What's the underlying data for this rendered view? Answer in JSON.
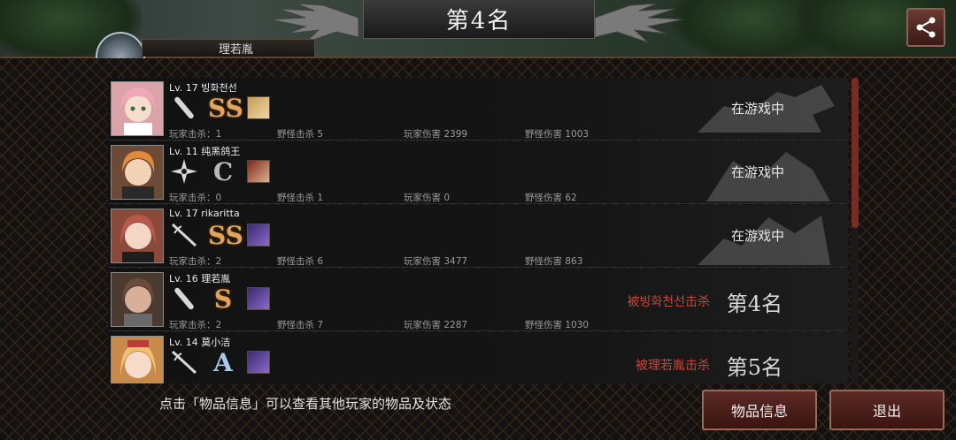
{
  "header": {
    "title": "第4名",
    "player_tag": "理若胤"
  },
  "players": [
    {
      "level_name": "Lv. 17 빙화천선",
      "grade": "SS",
      "status": "在游戏中",
      "killed_by": "",
      "rank": "",
      "stats": {
        "player_kills": "玩家击杀：1",
        "monster_kills": "野怪击杀 5",
        "player_damage": "玩家伤害 2399",
        "monster_damage": "野怪伤害 1003"
      }
    },
    {
      "level_name": "Lv. 11 纯黑鸽王",
      "grade": "C",
      "status": "在游戏中",
      "killed_by": "",
      "rank": "",
      "stats": {
        "player_kills": "玩家击杀：0",
        "monster_kills": "野怪击杀 1",
        "player_damage": "玩家伤害 0",
        "monster_damage": "野怪伤害 62"
      }
    },
    {
      "level_name": "Lv. 17 rikaritta",
      "grade": "SS",
      "status": "在游戏中",
      "killed_by": "",
      "rank": "",
      "stats": {
        "player_kills": "玩家击杀：2",
        "monster_kills": "野怪击杀 6",
        "player_damage": "玩家伤害 3477",
        "monster_damage": "野怪伤害 863"
      }
    },
    {
      "level_name": "Lv. 16 理若胤",
      "grade": "S",
      "status": "",
      "killed_by": "被빙화천선击杀",
      "rank": "第4名",
      "stats": {
        "player_kills": "玩家击杀：2",
        "monster_kills": "野怪击杀 7",
        "player_damage": "玩家伤害 2287",
        "monster_damage": "野怪伤害 1030"
      }
    },
    {
      "level_name": "Lv. 14 莫小洁",
      "grade": "A",
      "status": "",
      "killed_by": "被理若胤击杀",
      "rank": "第5名",
      "stats": {
        "player_kills": "",
        "monster_kills": "",
        "player_damage": "",
        "monster_damage": ""
      }
    }
  ],
  "footer": {
    "hint": "点击「物品信息」可以查看其他玩家的物品及状态",
    "items_button": "物品信息",
    "exit_button": "退出"
  },
  "icons": {
    "share": "share-icon",
    "weapons": [
      "bat-icon",
      "shuriken-icon",
      "rapier-icon",
      "bat-icon",
      "rapier-icon"
    ]
  },
  "colors": {
    "killed_text": "#c24a3a",
    "button_bg": "#5c2a24",
    "grade_gold": "#e0a55a"
  }
}
